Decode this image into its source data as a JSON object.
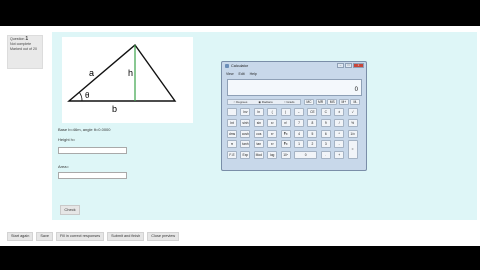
{
  "question_info": {
    "label": "Question",
    "number": "1",
    "status": "Not complete",
    "marks": "Marked out of 20"
  },
  "figure": {
    "labels": {
      "a": "a",
      "h": "h",
      "b": "b",
      "theta": "θ"
    }
  },
  "question": {
    "given_text": "Base b=46m, angle θ=0.0000",
    "height_label": "Height h=",
    "height_value": "",
    "area_label": "Area=",
    "area_value": "",
    "check_label": "Check"
  },
  "calculator": {
    "title": "Calculator",
    "menu": [
      "View",
      "Edit",
      "Help"
    ],
    "display": "0",
    "angle_modes": [
      "Degrees",
      "Radians",
      "Grads"
    ],
    "keys": [
      [
        "",
        "Inv",
        "ln",
        "(",
        ")",
        "←",
        "CE",
        "C",
        "±",
        "√"
      ],
      [
        "Int",
        "sinh",
        "sin",
        "x²",
        "n!",
        "7",
        "8",
        "9",
        "/",
        "%"
      ],
      [
        "dms",
        "cosh",
        "cos",
        "xʸ",
        "∛x",
        "4",
        "5",
        "6",
        "*",
        "1/x"
      ],
      [
        "π",
        "tanh",
        "tan",
        "x³",
        "∛x",
        "1",
        "2",
        "3",
        "-",
        "="
      ],
      [
        "F-E",
        "Exp",
        "Mod",
        "log",
        "10ˣ",
        "0",
        "",
        ".",
        "+",
        ""
      ]
    ],
    "memory_keys": [
      "MC",
      "MR",
      "MS",
      "M+",
      "M-"
    ]
  },
  "nav": [
    "Start again",
    "Save",
    "Fill in correct responses",
    "Submit and finish",
    "Close preview"
  ],
  "colors": {
    "content_bg": "#def6f7",
    "triangle_height": "#3aa34a"
  }
}
